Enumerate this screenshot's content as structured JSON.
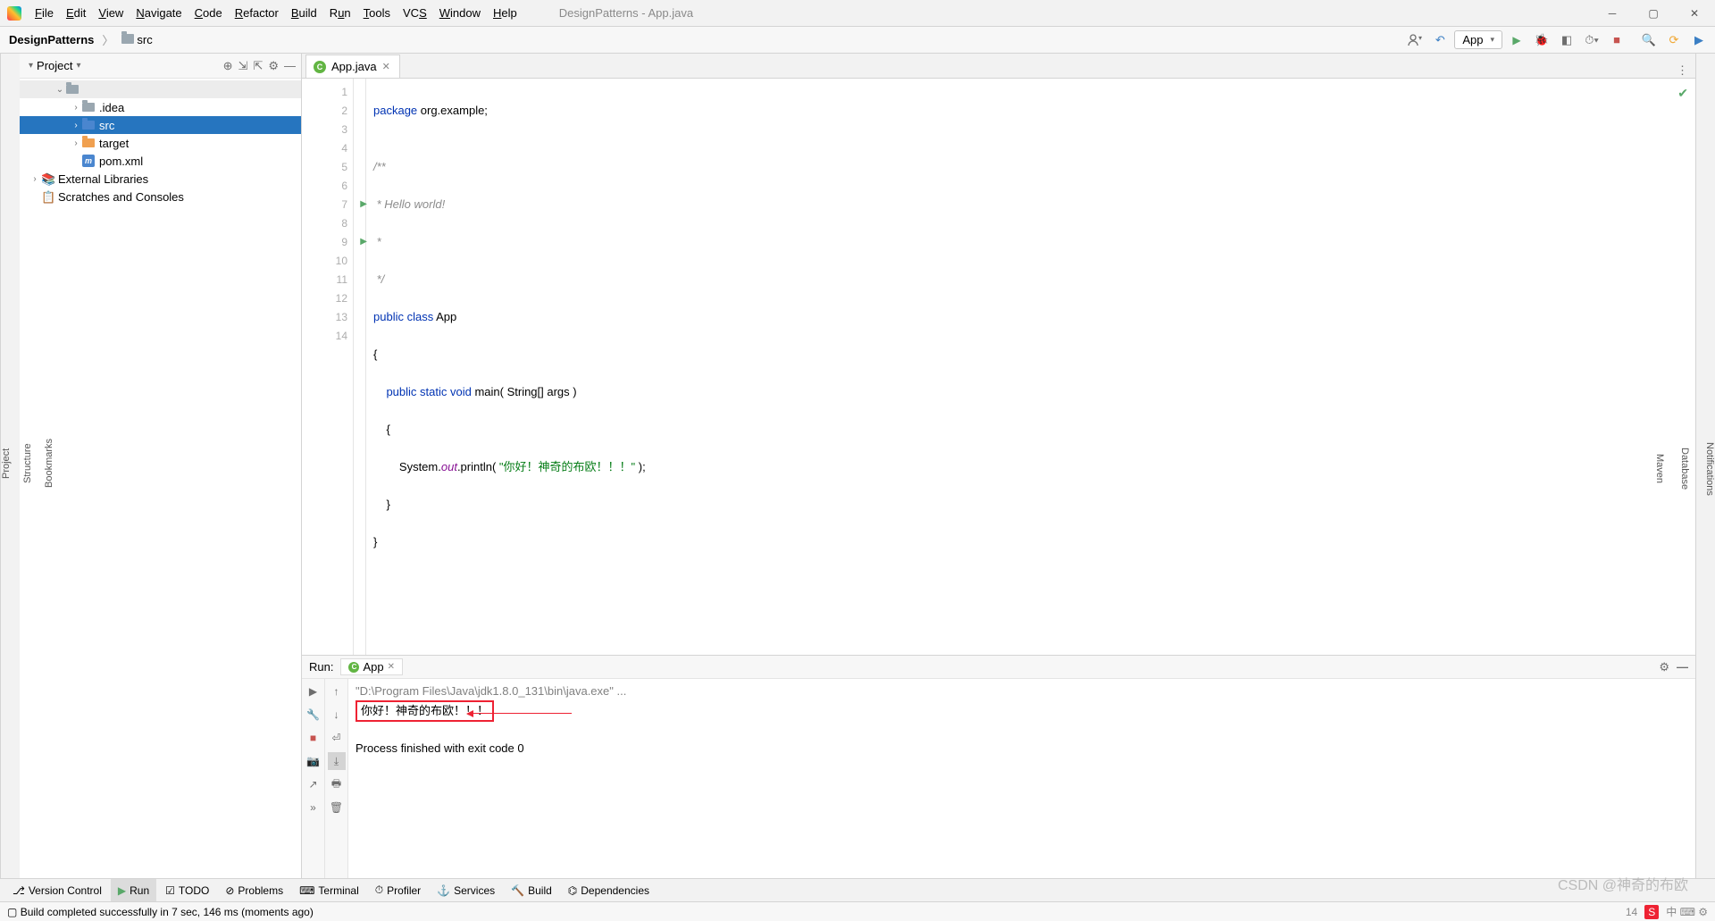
{
  "window": {
    "title": "DesignPatterns - App.java"
  },
  "menu": [
    "File",
    "Edit",
    "View",
    "Navigate",
    "Code",
    "Refactor",
    "Build",
    "Run",
    "Tools",
    "VCS",
    "Window",
    "Help"
  ],
  "breadcrumb": {
    "root": "DesignPatterns",
    "child": "src"
  },
  "runConfig": "App",
  "projectPanel": {
    "title": "Project"
  },
  "tree": {
    "idea": ".idea",
    "src": "src",
    "target": "target",
    "pom": "pom.xml",
    "ext": "External Libraries",
    "scratch": "Scratches and Consoles"
  },
  "tab": {
    "name": "App.java"
  },
  "code": {
    "l1_kw": "package",
    "l1_rest": " org.example;",
    "l2": "",
    "l3": "/**",
    "l4": " * Hello world!",
    "l5": " *",
    "l6": " */",
    "l7_kw": "public class",
    "l7_name": " App",
    "l8": "{",
    "l9_kw": "public static void",
    "l9_name": " main",
    "l9_rest": "( String[] args )",
    "l10": "    {",
    "l11_pre": "        System.",
    "l11_out": "out",
    "l11_mid": ".println( ",
    "l11_str": "\"你好！神奇的布欧！！！\"",
    "l11_post": " );",
    "l12": "    }",
    "l13": "}",
    "l14": ""
  },
  "gutter": [
    "1",
    "2",
    "3",
    "4",
    "5",
    "6",
    "7",
    "8",
    "9",
    "10",
    "11",
    "12",
    "13",
    "14"
  ],
  "runHeader": {
    "label": "Run:",
    "config": "App"
  },
  "console": {
    "cmd": "\"D:\\Program Files\\Java\\jdk1.8.0_131\\bin\\java.exe\" ...",
    "output": "你好！神奇的布欧！！！",
    "exit": "Process finished with exit code 0"
  },
  "bottomTabs": {
    "vc": "Version Control",
    "run": "Run",
    "todo": "TODO",
    "problems": "Problems",
    "terminal": "Terminal",
    "profiler": "Profiler",
    "services": "Services",
    "build": "Build",
    "deps": "Dependencies"
  },
  "status": {
    "msg": "Build completed successfully in 7 sec, 146 ms (moments ago)",
    "lncol": "14"
  },
  "leftStripe": {
    "project": "Project",
    "structure": "Structure",
    "bookmarks": "Bookmarks"
  },
  "rightStripe": {
    "notifications": "Notifications",
    "database": "Database",
    "maven": "Maven"
  },
  "watermark": "CSDN @神奇的布欧"
}
